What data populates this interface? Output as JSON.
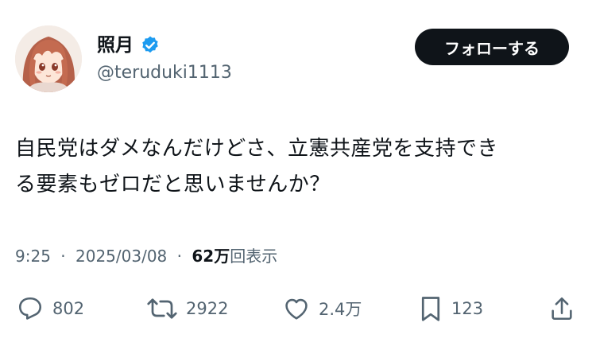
{
  "user": {
    "display_name": "照月",
    "handle": "@teruduki1113",
    "verified": true,
    "avatar_icon": "anime-girl-avatar"
  },
  "follow_button": {
    "label": "フォローする"
  },
  "tweet": {
    "text_line1": "自民党はダメなんだけどさ、立憲共産党を支持でき",
    "text_line2": "る要素もゼロだと思いませんか？",
    "time": "9:25",
    "separator": "·",
    "date": "2025/03/08",
    "views_count": "62万",
    "views_label": "回表示"
  },
  "actions": {
    "reply_count": "802",
    "retweet_count": "2922",
    "like_count": "2.4万",
    "bookmark_count": "123"
  },
  "colors": {
    "text": "#0f1419",
    "secondary": "#536471",
    "verified": "#1d9bf0",
    "button_bg": "#0f1419"
  }
}
